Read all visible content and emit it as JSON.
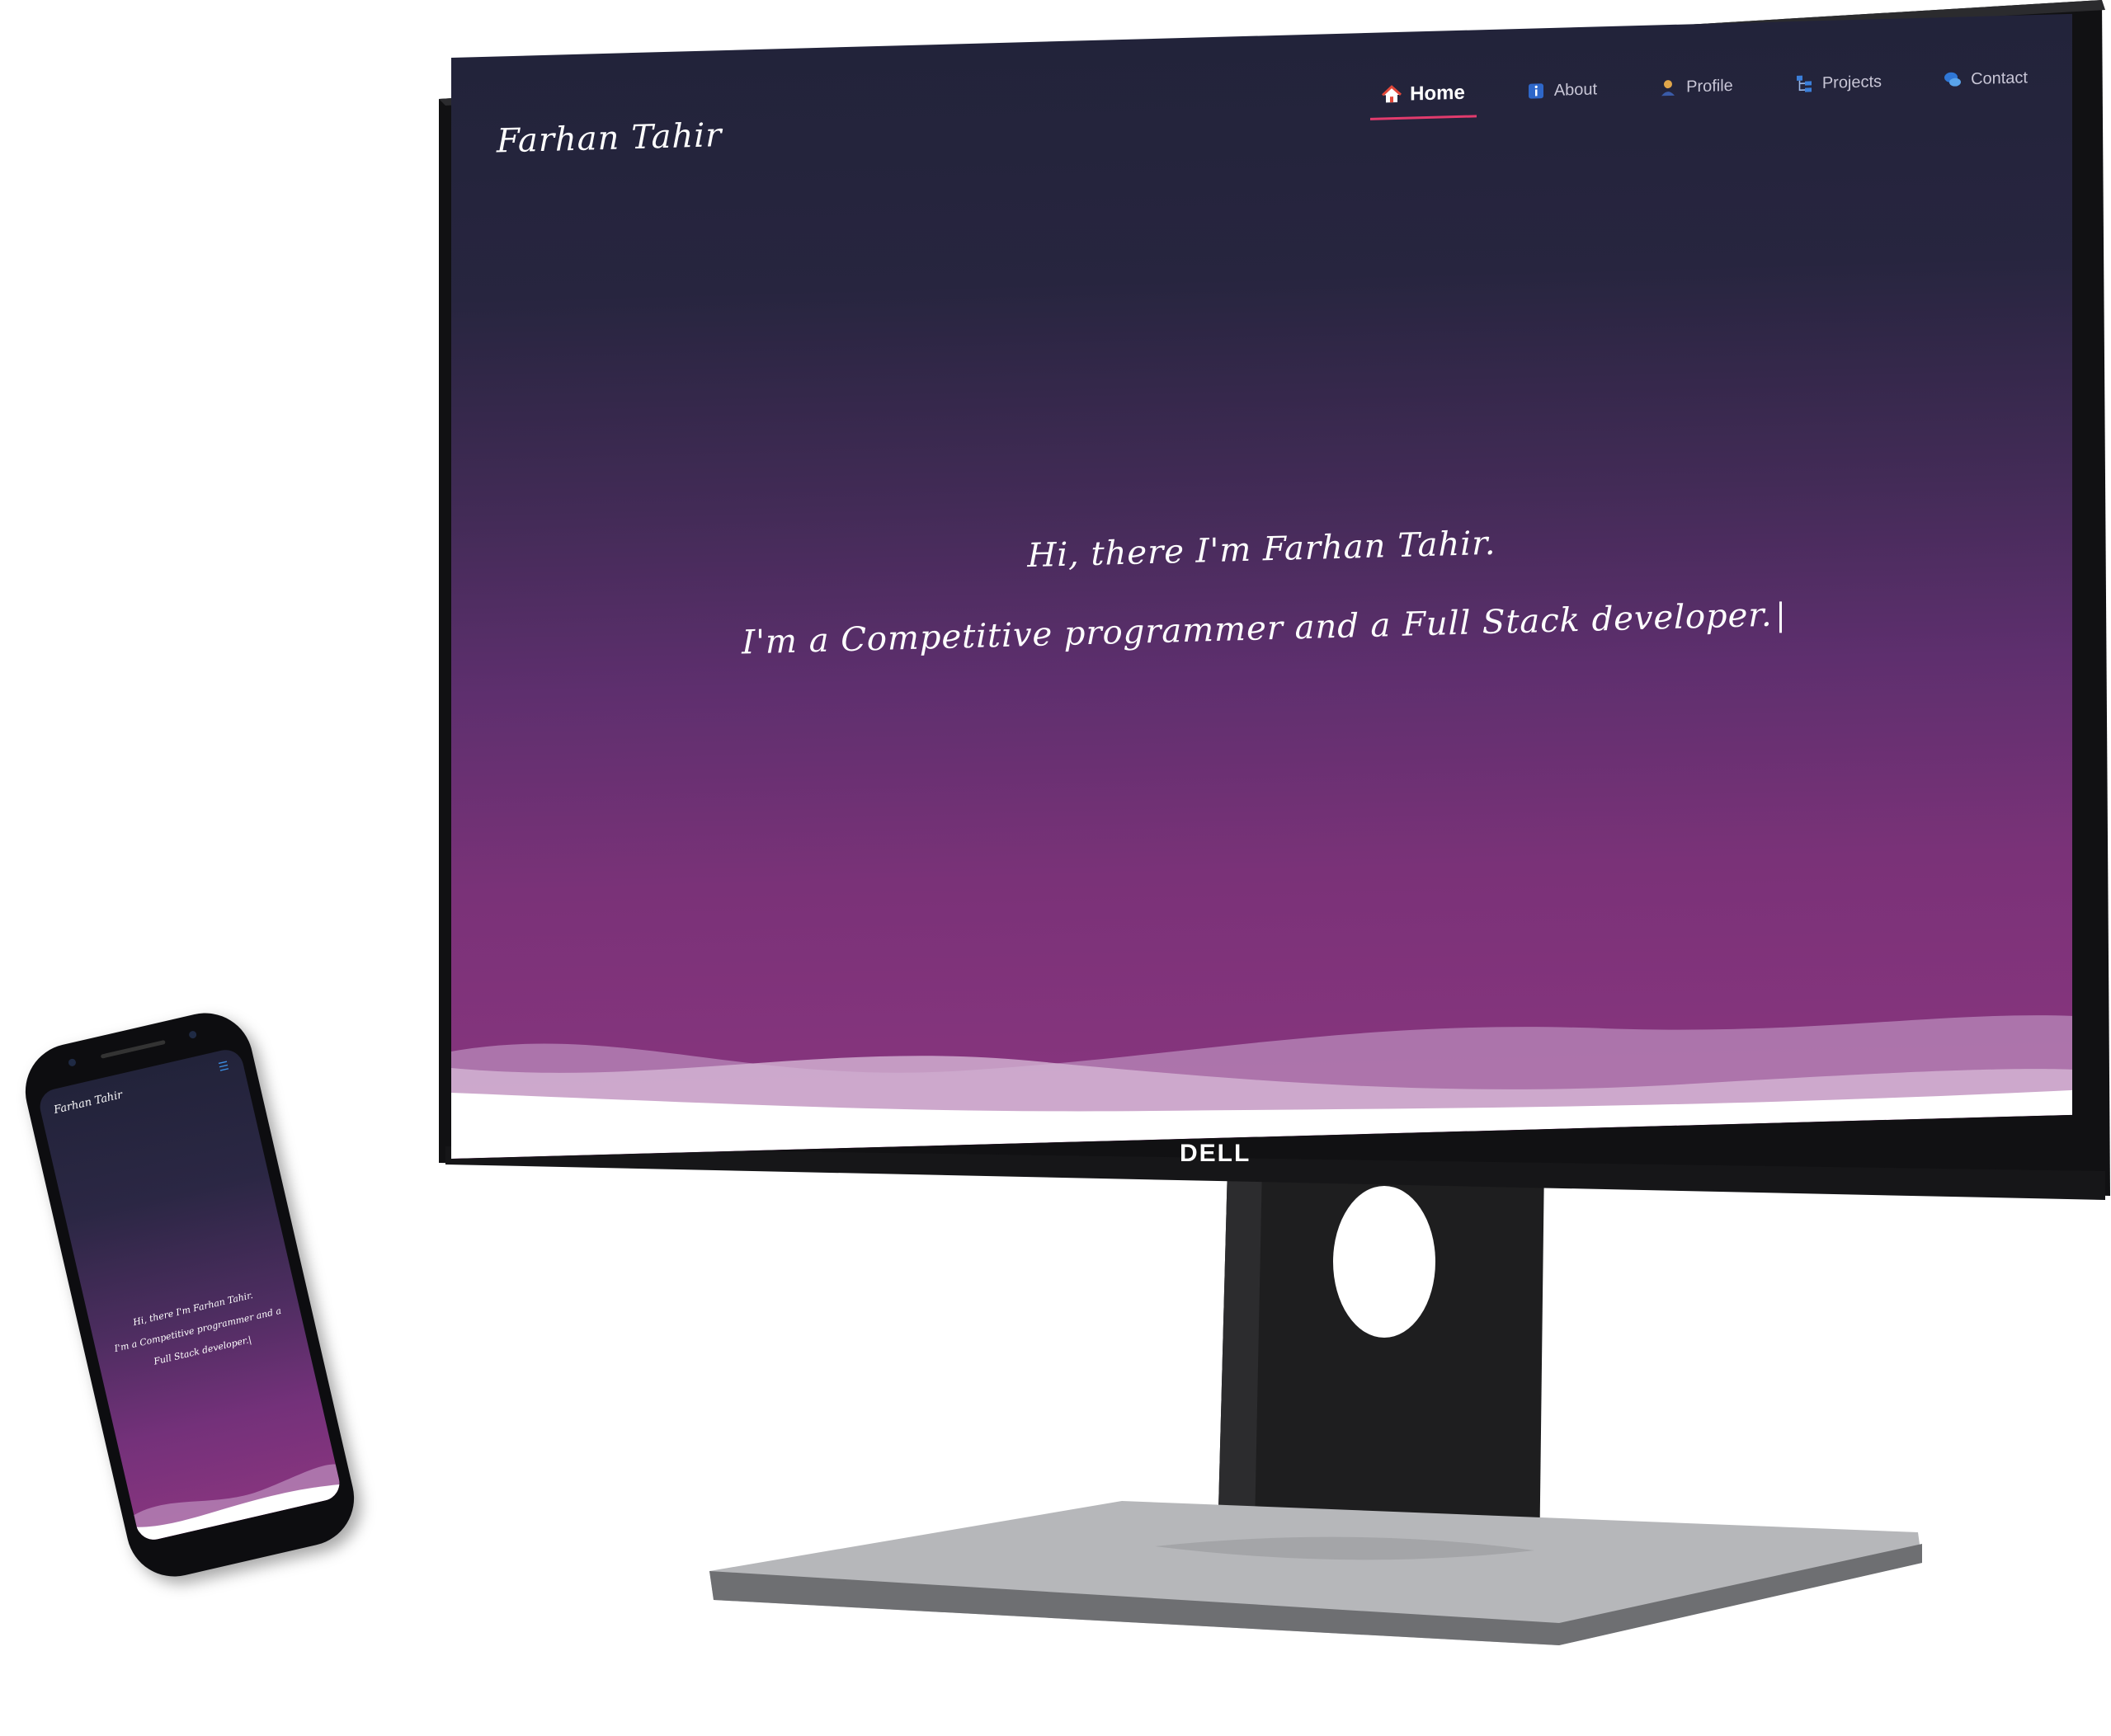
{
  "desktop": {
    "brand": "Farhan Tahir",
    "nav": [
      {
        "label": "Home",
        "icon": "home-icon",
        "active": true
      },
      {
        "label": "About",
        "icon": "info-icon",
        "active": false
      },
      {
        "label": "Profile",
        "icon": "person-icon",
        "active": false
      },
      {
        "label": "Projects",
        "icon": "hierarchy-icon",
        "active": false
      },
      {
        "label": "Contact",
        "icon": "chat-icon",
        "active": false
      }
    ],
    "hero_line1": "Hi, there I'm Farhan Tahir.",
    "hero_line2": "I'm a Competitive programmer and a Full Stack developer."
  },
  "monitor_brand": "DELL",
  "mobile": {
    "brand": "Farhan Tahir",
    "hero_line1": "Hi, there I'm Farhan Tahir.",
    "hero_line2": "I'm a Competitive programmer and a",
    "hero_line3": "Full Stack developer.|"
  },
  "colors": {
    "accent": "#e23b6d",
    "gradient_top": "#22233a",
    "gradient_bottom": "#8a357f"
  }
}
